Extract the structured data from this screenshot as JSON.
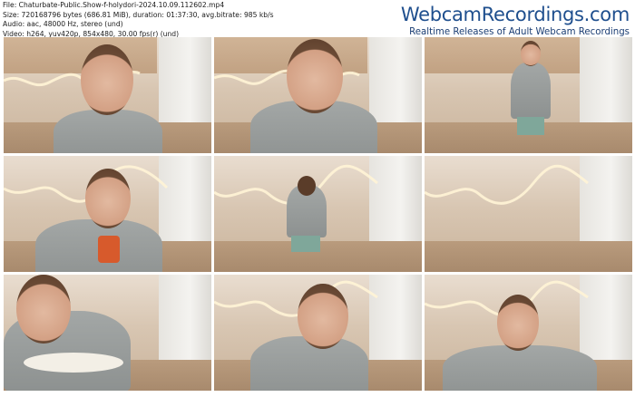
{
  "file_info": {
    "line1": "File: Chaturbate-Public.Show-f-holydori-2024.10.09.112602.mp4",
    "line2": "Size: 720168796 bytes (686.81 MiB), duration: 01:37:30, avg.bitrate: 985 kb/s",
    "line3": "Audio: aac, 48000 Hz, stereo (und)",
    "line4": "Video: h264, yuv420p, 854x480, 30.00 fps(r) (und)"
  },
  "brand": {
    "name": "WebcamRecordings.com",
    "tagline": "Realtime Releases of Adult Webcam Recordings"
  },
  "colors": {
    "brand_blue": "#1f4f8e",
    "tagline_blue": "#1a3d73",
    "neon": "#fff4d6"
  },
  "thumbnails": [
    {
      "id": 1,
      "scene": "closeup-hands-clasped"
    },
    {
      "id": 2,
      "scene": "closeup-looking-down"
    },
    {
      "id": 3,
      "scene": "standing-by-stove"
    },
    {
      "id": 4,
      "scene": "drinking-juice"
    },
    {
      "id": 5,
      "scene": "cooking-back-turned"
    },
    {
      "id": 6,
      "scene": "empty-kitchen"
    },
    {
      "id": 7,
      "scene": "holding-plate"
    },
    {
      "id": 8,
      "scene": "eating-with-fork"
    },
    {
      "id": 9,
      "scene": "sitting-low"
    }
  ]
}
